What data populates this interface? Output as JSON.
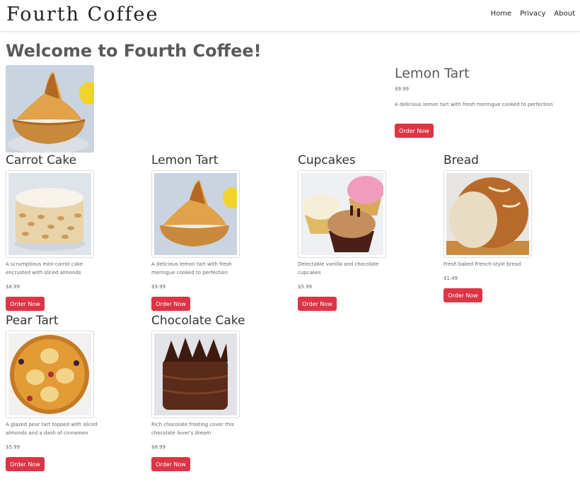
{
  "header": {
    "brand": "Fourth Coffee",
    "nav": [
      "Home",
      "Privacy",
      "About"
    ]
  },
  "welcome": "Welcome to Fourth Coffee!",
  "hero": {
    "title": "Lemon Tart",
    "price": "$9.99",
    "description": "A delicious lemon tart with fresh meringue cooked to perfection",
    "button": "Order Now"
  },
  "products": [
    {
      "name": "Carrot Cake",
      "description": "A scrumptious mini-carrot cake encrusted with sliced almonds",
      "price": "$8.99",
      "button": "Order Now"
    },
    {
      "name": "Lemon Tart",
      "description": "A delicious lemon tart with fresh meringue cooked to perfection",
      "price": "$9.99",
      "button": "Order Now"
    },
    {
      "name": "Cupcakes",
      "description": "Delectable vanilla and chocolate cupcakes",
      "price": "$5.99",
      "button": "Order Now"
    },
    {
      "name": "Bread",
      "description": "Fresh baked French-style bread",
      "price": "$1.49",
      "button": "Order Now"
    },
    {
      "name": "Pear Tart",
      "description": "A glazed pear tart topped with sliced almonds and a dash of cinnamon",
      "price": "$5.99",
      "button": "Order Now"
    },
    {
      "name": "Chocolate Cake",
      "description": "Rich chocolate frosting cover this chocolate lover's dream",
      "price": "$8.99",
      "button": "Order Now"
    }
  ],
  "colors": {
    "accent": "#dc3545",
    "heading": "#5a5a5a"
  }
}
